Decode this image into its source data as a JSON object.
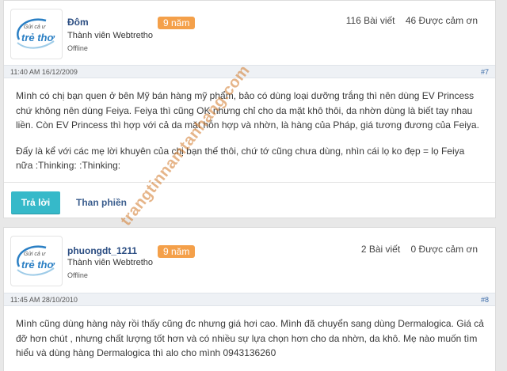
{
  "posts": [
    {
      "username": "Đôm",
      "badge": "9 năm",
      "rank": "Thành viên Webtretho",
      "status": "Offline",
      "post_count": "116 Bài viết",
      "thanks": "46 Được cảm ơn",
      "timestamp": "11:40 AM 16/12/2009",
      "post_number": "#7",
      "paragraphs": [
        "Mình có chị bạn quen ở bên Mỹ bán hàng mỹ phẩm, bảo có dùng loại dưỡng trắng thì nên dùng EV Princess chứ không nên dùng Feiya. Feiya thì cũng OK nhưng chỉ cho da mặt khô thôi, da nhờn dùng là biết tay nhau liền. Còn EV Princess thì hợp với cả da mặt hỗn hợp và nhờn, là hàng của Pháp, giá tương đương của Feiya.",
        "Đấy là kể với các mẹ lời khuyên của chị bạn thế thôi, chứ tớ cũng chưa dùng, nhìn cái lọ ko đẹp = lọ Feiya nữa :Thinking: :Thinking:"
      ],
      "reply_label": "Trả lời",
      "report_label": "Than phiền"
    },
    {
      "username": "phuongdt_1211",
      "badge": "9 năm",
      "rank": "Thành viên Webtretho",
      "status": "Offline",
      "post_count": "2 Bài viết",
      "thanks": "0 Được cảm ơn",
      "timestamp": "11:45 AM 28/10/2010",
      "post_number": "#8",
      "paragraphs": [
        "Mình cũng dùng hàng này rồi thấy cũng đc nhưng giá hơi cao. Mình đã chuyển sang dùng Dermalogica. Giá cả đỡ hơn chút , nhưng chất lượng tốt hơn và có nhiều sự lựa chọn hơn cho da nhờn, da khô. Mẹ nào muốn tìm hiểu và dùng hàng Dermalogica thì alo cho mình 0943136260"
      ]
    }
  ],
  "avatar_text": {
    "line1": "Gửi cả ư",
    "line2": "trẻ thơ"
  },
  "watermark": "trangtinnamtanhang.com",
  "colors": {
    "badge": "#f4a04a",
    "reply_button": "#36b9c9",
    "username": "#2b4d82",
    "logo": "#2a7fc4"
  }
}
